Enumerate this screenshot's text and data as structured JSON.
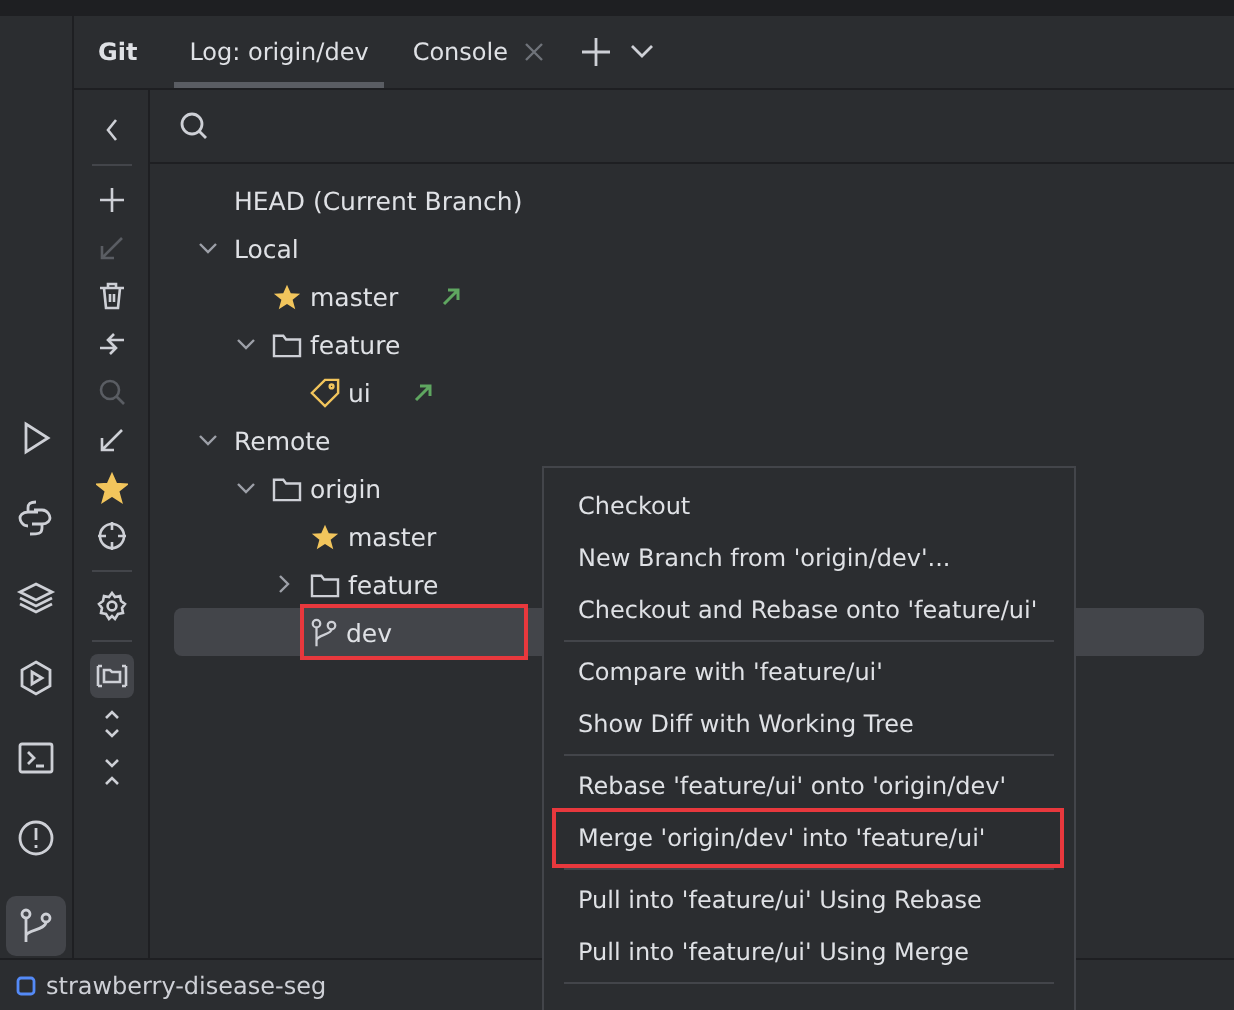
{
  "strip": [
    {
      "kind": "run",
      "selected": false
    },
    {
      "kind": "python",
      "selected": false
    },
    {
      "kind": "layers",
      "selected": false
    },
    {
      "kind": "services",
      "selected": false
    },
    {
      "kind": "terminal",
      "selected": false
    },
    {
      "kind": "problems",
      "selected": false
    },
    {
      "kind": "git",
      "selected": true
    }
  ],
  "panel_title": "Git",
  "tabs": [
    {
      "label": "Log: origin/dev",
      "selected": true,
      "closable": false
    },
    {
      "label": "Console",
      "selected": false,
      "closable": true
    }
  ],
  "toolbar": [
    {
      "kind": "back",
      "disabled": false,
      "selected": false
    },
    {
      "kind": "plus",
      "disabled": false,
      "selected": false
    },
    {
      "kind": "arrow",
      "disabled": true,
      "selected": false
    },
    {
      "kind": "trash",
      "disabled": false,
      "selected": false
    },
    {
      "kind": "compare",
      "disabled": false,
      "selected": false
    },
    {
      "kind": "search",
      "disabled": true,
      "selected": false
    },
    {
      "kind": "arrow",
      "disabled": false,
      "selected": false
    },
    {
      "kind": "star",
      "disabled": false,
      "selected": false
    },
    {
      "kind": "target",
      "disabled": false,
      "selected": false
    },
    {
      "kind": "gear",
      "disabled": false,
      "selected": false
    },
    {
      "kind": "folder",
      "disabled": false,
      "selected": true
    },
    {
      "kind": "expand",
      "disabled": false,
      "selected": false
    },
    {
      "kind": "collapse",
      "disabled": false,
      "selected": false
    }
  ],
  "tree": [
    {
      "label": "HEAD (Current Branch)",
      "selected": false
    },
    {
      "label": "Local",
      "expanded": true,
      "selected": false,
      "children": [
        {
          "label": "master",
          "kind": "star",
          "tracked": true,
          "selected": false
        },
        {
          "label": "feature",
          "kind": "folder",
          "expanded": true,
          "selected": false,
          "children": [
            {
              "label": "ui",
              "kind": "tag",
              "tracked": true,
              "selected": false
            }
          ]
        }
      ]
    },
    {
      "label": "Remote",
      "expanded": true,
      "selected": false,
      "children": [
        {
          "label": "origin",
          "kind": "folder",
          "expanded": true,
          "selected": false,
          "children": [
            {
              "label": "master",
              "kind": "star",
              "selected": false
            },
            {
              "label": "feature",
              "kind": "folder",
              "expanded": false,
              "selected": false
            },
            {
              "label": "dev",
              "kind": "branch",
              "selected": true,
              "annotated": true
            }
          ]
        }
      ]
    }
  ],
  "context_menu": {
    "groups": [
      [
        {
          "label": "Checkout"
        },
        {
          "label": "New Branch from 'origin/dev'..."
        },
        {
          "label": "Checkout and Rebase onto 'feature/ui'"
        }
      ],
      [
        {
          "label": "Compare with 'feature/ui'"
        },
        {
          "label": "Show Diff with Working Tree"
        }
      ],
      [
        {
          "label": "Rebase 'feature/ui' onto 'origin/dev'"
        },
        {
          "label": "Merge 'origin/dev' into 'feature/ui'",
          "annotated": true
        }
      ],
      [
        {
          "label": "Pull into 'feature/ui' Using Rebase"
        },
        {
          "label": "Pull into 'feature/ui' Using Merge"
        }
      ]
    ]
  },
  "status_bar": {
    "project": "strawberry-disease-seg"
  }
}
